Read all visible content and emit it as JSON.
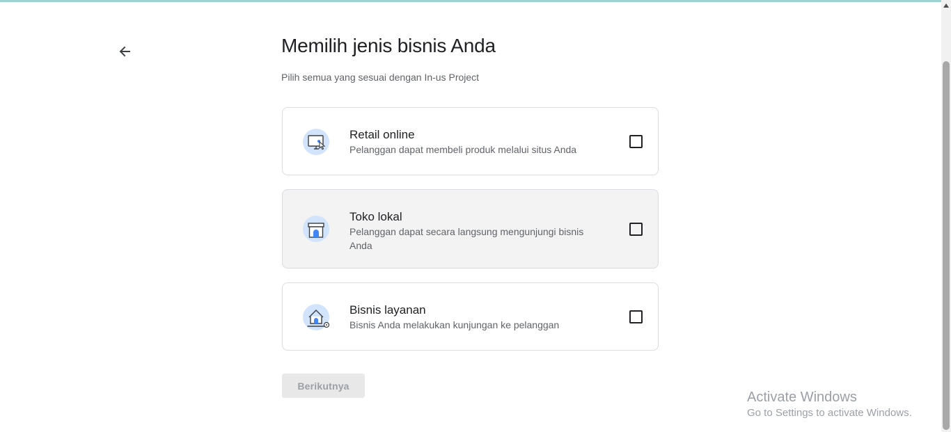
{
  "page": {
    "title": "Memilih jenis bisnis Anda",
    "subtitle": "Pilih semua yang sesuai dengan In-us Project"
  },
  "options": [
    {
      "name": "Retail online",
      "description": "Pelanggan dapat membeli produk melalui situs Anda",
      "icon": "monitor-cursor-icon",
      "checked": false
    },
    {
      "name": "Toko lokal",
      "description": "Pelanggan dapat secara langsung mengunjungi bisnis Anda",
      "icon": "storefront-icon",
      "checked": false
    },
    {
      "name": "Bisnis layanan",
      "description": "Bisnis Anda melakukan kunjungan ke pelanggan",
      "icon": "house-location-icon",
      "checked": false
    }
  ],
  "next_button": {
    "label": "Berikutnya",
    "enabled": false
  },
  "watermark": {
    "line1": "Activate Windows",
    "line2": "Go to Settings to activate Windows."
  },
  "colors": {
    "icon_bg": "#d2e3fc",
    "icon_accent": "#4285f4",
    "disabled_button": "#e8e8e8"
  }
}
